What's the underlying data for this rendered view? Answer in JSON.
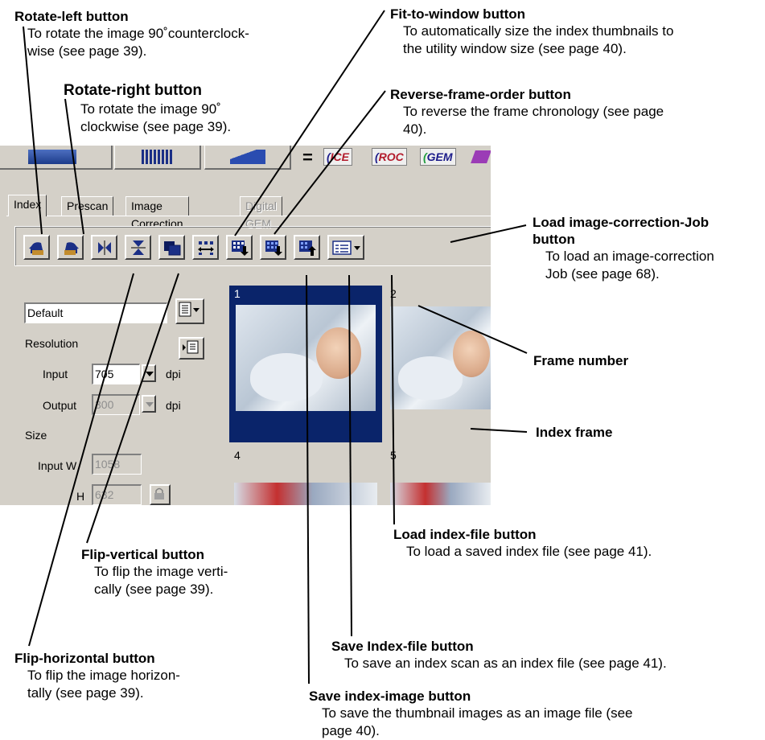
{
  "annotations": {
    "rotate_left": {
      "title": "Rotate-left button",
      "desc": "To rotate the image 90˚counterclock-\nwise (see page 39)."
    },
    "rotate_right": {
      "title": "Rotate-right button",
      "desc": "To rotate the image 90˚\nclockwise (see page 39)."
    },
    "fit_to_window": {
      "title": "Fit-to-window button",
      "desc": "To automatically size the index thumbnails to\nthe utility window size (see page 40)."
    },
    "reverse_frame_order": {
      "title": "Reverse-frame-order button",
      "desc": "To reverse the frame chronology (see page\n40)."
    },
    "load_job": {
      "title": "Load image-correction-Job\nbutton",
      "desc": "To load an image-correction\nJob (see page 68)."
    },
    "frame_number": {
      "title": "Frame number"
    },
    "index_frame": {
      "title": "Index frame"
    },
    "load_index_file": {
      "title": "Load index-file button",
      "desc": "To load a saved index file (see page 41)."
    },
    "flip_vertical": {
      "title": "Flip-vertical button",
      "desc": "To flip the image verti-\ncally (see page 39)."
    },
    "save_index_file": {
      "title": "Save Index-file button",
      "desc": "To save an index scan as an index file (see page 41)."
    },
    "flip_horizontal": {
      "title": "Flip-horizontal button",
      "desc": "To flip the image horizon-\ntally (see page 39)."
    },
    "save_index_image": {
      "title": "Save index-image button",
      "desc": "To save the thumbnail images as an image file (see\npage 40)."
    }
  },
  "screenshot": {
    "top_badges": [
      "ICE",
      "ROC",
      "GEM"
    ],
    "tabs": [
      {
        "label": "Index",
        "active": true,
        "enabled": true
      },
      {
        "label": "Prescan",
        "active": false,
        "enabled": true
      },
      {
        "label": "Image Correction",
        "active": false,
        "enabled": true
      },
      {
        "label": "Digital GEM",
        "active": false,
        "enabled": false
      }
    ],
    "toolbar_icons": [
      "rotate-left-icon",
      "rotate-right-icon",
      "flip-horizontal-icon",
      "flip-vertical-icon",
      "fit-to-window-icon",
      "reverse-frame-order-icon",
      "save-index-image-icon",
      "save-index-file-icon",
      "load-index-file-icon",
      "load-job-icon"
    ],
    "settings": {
      "job_value": "Default",
      "resolution_label": "Resolution",
      "input_label": "Input",
      "input_value": "705",
      "input_unit": "dpi",
      "output_label": "Output",
      "output_value": "300",
      "output_unit": "dpi",
      "size_label": "Size",
      "input_w_label": "Input W",
      "input_w_value": "1058",
      "h_label": "H",
      "h_value": "632"
    },
    "frames": [
      {
        "number": "1",
        "selected": true
      },
      {
        "number": "2",
        "selected": false
      },
      {
        "number": "4",
        "selected": false
      },
      {
        "number": "5",
        "selected": false
      }
    ],
    "colors": {
      "selected_frame": "#0a246a",
      "window_face": "#d4d0c8",
      "toolbar_icon_blue": "#1b2f86"
    }
  }
}
